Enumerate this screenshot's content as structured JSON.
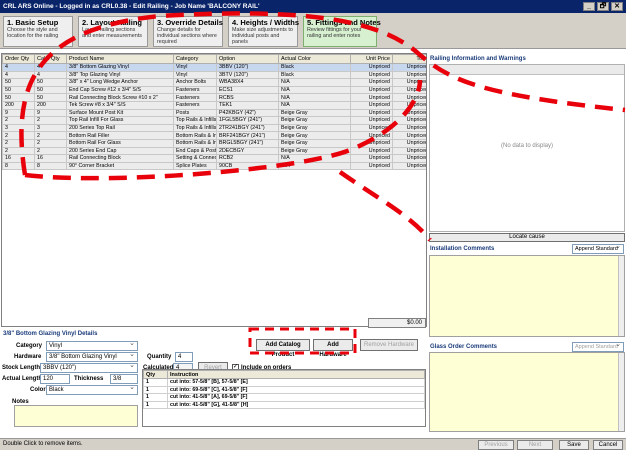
{
  "titlebar": {
    "title": "CRL ARS Online - Logged in as CRL0.38 - Edit Railing - Job Name 'BALCONY RAIL'",
    "btn_min": "_",
    "btn_restore": "🗗",
    "btn_close": "✕"
  },
  "steps": [
    {
      "title": "1. Basic Setup",
      "desc": "Choose the style and location for the railing"
    },
    {
      "title": "2. Layout Railing",
      "desc": "Layout railing sections and enter measurements"
    },
    {
      "title": "3. Override Details",
      "desc": "Change details for individual sections where required"
    },
    {
      "title": "4. Heights / Widths",
      "desc": "Make size adjustments to individual posts and panels"
    },
    {
      "title": "5. Fittings and Notes",
      "desc": "Review fittings for your railing and enter notes"
    }
  ],
  "grid": {
    "columns": [
      "Order Qty",
      "Calc. Qty",
      "Product Name",
      "Category",
      "Option",
      "Actual Color",
      "Unit Price",
      "Total"
    ],
    "rows": [
      [
        "4",
        "4",
        "3/8\" Bottom Glazing Vinyl",
        "Vinyl",
        "3BBV (120\")",
        "Black",
        "Unpriced",
        "Unpriced"
      ],
      [
        "4",
        "4",
        "3/8\" Top Glazing Vinyl",
        "Vinyl",
        "3BTV (120\")",
        "Black",
        "Unpriced",
        "Unpriced"
      ],
      [
        "50",
        "50",
        "3/8\" x 4\" Long Wedge Anchor",
        "Anchor Bolts",
        "WBA38X4",
        "N/A",
        "Unpriced",
        "Unpriced"
      ],
      [
        "50",
        "50",
        "End Cap Screw #12 x 3/4\" S/S",
        "Fasteners",
        "ECS1",
        "N/A",
        "Unpriced",
        "Unpriced"
      ],
      [
        "50",
        "50",
        "Rail Connecting Block Screw #10 x 2\"",
        "Fasteners",
        "RCBS",
        "N/A",
        "Unpriced",
        "Unpriced"
      ],
      [
        "200",
        "200",
        "Tek Screw #8 x 3/4\" S/S",
        "Fasteners",
        "TEK1",
        "N/A",
        "Unpriced",
        "Unpriced"
      ],
      [
        "9",
        "9",
        "Surface Mount Post Kit",
        "Posts",
        "P42KBGY (42\")",
        "Beige Gray",
        "Unpriced",
        "Unpriced"
      ],
      [
        "2",
        "2",
        "Top Rail Infill For Glass",
        "Top Rails & Infills",
        "1FGL5BGY (241\")",
        "Beige Gray",
        "Unpriced",
        "Unpriced"
      ],
      [
        "3",
        "3",
        "200 Series Top Rail",
        "Top Rails & Infills",
        "2TR241BGY (241\")",
        "Beige Gray",
        "Unpriced",
        "Unpriced"
      ],
      [
        "2",
        "2",
        "Bottom Rail Filler",
        "Bottom Rails & Infills",
        "BRF241BGY (241\")",
        "Beige Gray",
        "Unpriced",
        "Unpriced"
      ],
      [
        "2",
        "2",
        "Bottom Rail For Glass",
        "Bottom Rails & Infills",
        "BRGL5BGY (241\")",
        "Beige Gray",
        "Unpriced",
        "Unpriced"
      ],
      [
        "2",
        "2",
        "200 Series End Cap",
        "End Caps & Posts",
        "2DECBGY",
        "Beige Gray",
        "Unpriced",
        "Unpriced"
      ],
      [
        "16",
        "16",
        "Rail Connecting Block",
        "Setting & Connecting",
        "RCB2",
        "N/A",
        "Unpriced",
        "Unpriced"
      ],
      [
        "8",
        "8",
        "90° Corner Bracket",
        "Splice Plates",
        "90CB",
        "N/A",
        "Unpriced",
        "Unpriced"
      ]
    ],
    "total": "$0.00"
  },
  "details": {
    "title": "3/8\" Bottom Glazing Vinyl Details",
    "category_label": "Category",
    "category_value": "Vinyl",
    "hardware_label": "Hardware",
    "hardware_value": "3/8\" Bottom Glazing Vinyl",
    "stock_label": "Stock Length",
    "stock_value": "3BBV (120\")",
    "actual_label": "Actual Length",
    "actual_value": "120",
    "thickness_label": "Thickness",
    "thickness_value": "3/8",
    "color_label": "Color",
    "color_value": "Black",
    "notes_label": "Notes",
    "quantity_label": "Quantity",
    "quantity_value": "4",
    "calculated_label": "Calculated",
    "calculated_value": "4",
    "revert_label": "Revert",
    "include_label": "Include on orders",
    "cut_columns": [
      "Qty",
      "Instruction"
    ],
    "cuts": [
      [
        "1",
        "cut into: 57-5/8\" [B], 57-5/8\" [E]"
      ],
      [
        "1",
        "cut into: 69-5/8\" [C], 41-5/8\" [F]"
      ],
      [
        "1",
        "cut into: 41-5/8\" [A], 69-5/8\" [F]"
      ],
      [
        "1",
        "cut into: 41-5/8\" [G], 41-5/8\" [H]"
      ]
    ]
  },
  "actions": {
    "add_catalog": "Add Catalog Product",
    "add_hardware": "Add Hardware",
    "remove_hardware": "Remove Hardware"
  },
  "right": {
    "info_title": "Railing Information and Warnings",
    "no_data": "(No data to display)",
    "locate": "Locate cause",
    "install_title": "Installation Comments",
    "install_dd": "Append Standard",
    "glass_title": "Glass Order Comments",
    "glass_dd": "Append Standard"
  },
  "statusbar": {
    "text": "Double Click to remove items.",
    "previous": "Previous",
    "next": "Next",
    "save": "Save",
    "cancel": "Cancel"
  }
}
